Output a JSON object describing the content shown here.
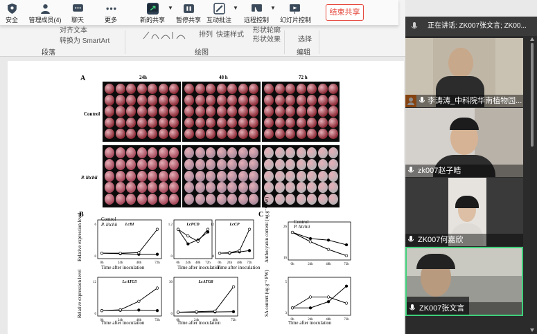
{
  "toolbar": {
    "items": [
      {
        "label": "安全",
        "icon": "shield-icon"
      },
      {
        "label": "管理成员(4)",
        "icon": "members-icon"
      },
      {
        "label": "聊天",
        "icon": "chat-icon"
      },
      {
        "label": "更多",
        "icon": "more-icon"
      },
      {
        "label": "新的共享",
        "icon": "share-icon"
      },
      {
        "label": "暂停共享",
        "icon": "pause-icon"
      },
      {
        "label": "互动批注",
        "icon": "annotate-icon"
      },
      {
        "label": "远程控制",
        "icon": "remote-control-icon"
      },
      {
        "label": "幻灯片控制",
        "icon": "slideshow-icon"
      }
    ],
    "end_share": "结束共享"
  },
  "ribbon": {
    "snippets": [
      "对齐文本",
      "转换为 SmartArt",
      "形状轮廓",
      "排列",
      "快速样式",
      "形状效果",
      "选择"
    ],
    "groups": [
      "段落",
      "绘图",
      "编辑"
    ]
  },
  "meeting": {
    "speaking": "正在讲话: ZK007张文言; ZK00...",
    "participants": [
      {
        "name": "李涛涛_中科院华南植物园...",
        "host": true
      },
      {
        "name": "zk007赵子皓",
        "host": false
      },
      {
        "name": "ZK007何嘉欣",
        "host": false
      },
      {
        "name": "ZK007张文言",
        "host": false
      }
    ]
  },
  "figure": {
    "panel_a": "A",
    "panel_b": "B",
    "panel_c": "C",
    "timepoints": [
      "24h",
      "48 h",
      "72 h"
    ],
    "rows": [
      "Control",
      "P. litchii"
    ],
    "legend": [
      "Control",
      "P. litchii"
    ],
    "xlabel": "Time after inoculation",
    "ylabel_rel": "Relative expression level",
    "ylabel_anth": "Anthocyanin content (ug g⁻¹ FW)",
    "ylabel_sa": "SA content (ug g⁻¹ FW)"
  },
  "chart_data": [
    {
      "type": "line",
      "title": "LcBI",
      "categories": [
        "0h",
        "24h",
        "48h",
        "72h"
      ],
      "ylim": [
        0,
        6
      ],
      "series": [
        {
          "name": "Control",
          "values": [
            0.5,
            0.4,
            0.3,
            0.3
          ]
        },
        {
          "name": "P. litchii",
          "values": [
            0.5,
            0.5,
            0.6,
            5.0
          ]
        }
      ]
    },
    {
      "type": "line",
      "title": "LcPCD",
      "categories": [
        "0h",
        "24h",
        "48h",
        "72h"
      ],
      "ylim": [
        0,
        1.2
      ],
      "series": [
        {
          "name": "Control",
          "values": [
            1.0,
            0.45,
            0.6,
            0.9
          ]
        },
        {
          "name": "P. litchii",
          "values": [
            1.0,
            0.75,
            0.55,
            1.0
          ]
        }
      ]
    },
    {
      "type": "line",
      "title": "LcCP",
      "categories": [
        "0h",
        "24h",
        "48h",
        "72h"
      ],
      "ylim": [
        0,
        12
      ],
      "series": [
        {
          "name": "Control",
          "values": [
            1,
            1,
            1.5,
            2
          ]
        },
        {
          "name": "P. litchii",
          "values": [
            1,
            1.2,
            2,
            10
          ]
        }
      ]
    },
    {
      "type": "line",
      "title": "LcATG5",
      "categories": [
        "0h",
        "24h",
        "48h",
        "72h"
      ],
      "ylim": [
        0,
        12
      ],
      "series": [
        {
          "name": "Control",
          "values": [
            1,
            1.1,
            1.2,
            1.0
          ]
        },
        {
          "name": "P. litchii",
          "values": [
            1,
            1.3,
            4.5,
            9.5
          ]
        }
      ]
    },
    {
      "type": "line",
      "title": "LcATG8",
      "categories": [
        "0h",
        "24h",
        "48h",
        "72h"
      ],
      "ylim": [
        0,
        30
      ],
      "series": [
        {
          "name": "Control",
          "values": [
            1,
            1,
            1.2,
            1.5
          ]
        },
        {
          "name": "P. litchii",
          "values": [
            1,
            1.5,
            2,
            25
          ]
        }
      ]
    },
    {
      "type": "line",
      "title": "",
      "categories": [
        "0h",
        "24h",
        "48h",
        "72h"
      ],
      "ylim": [
        16,
        26
      ],
      "series": [
        {
          "name": "Control",
          "values": [
            24,
            22,
            21.5,
            20
          ]
        },
        {
          "name": "P. litchii",
          "values": [
            24,
            21,
            18.5,
            16.5
          ]
        }
      ]
    },
    {
      "type": "line",
      "title": "",
      "categories": [
        "0h",
        "24h",
        "48h",
        "72h"
      ],
      "ylim": [
        3,
        5
      ],
      "series": [
        {
          "name": "Control",
          "values": [
            3.3,
            3.3,
            3.7,
            4.7
          ]
        },
        {
          "name": "P. litchii",
          "values": [
            3.3,
            4.0,
            4.0,
            3.6
          ]
        }
      ]
    }
  ]
}
